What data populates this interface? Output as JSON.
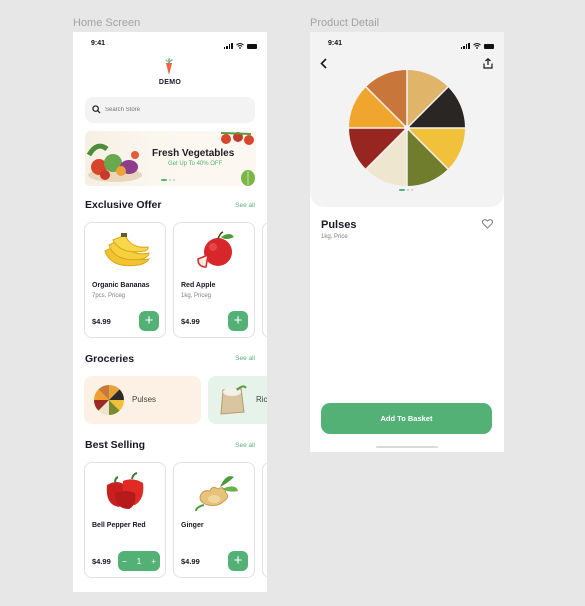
{
  "frames": {
    "home_label": "Home Screen",
    "detail_label": "Product Detail"
  },
  "colors": {
    "accent": "#53b175",
    "text": "#181725",
    "muted": "#7c7c7c",
    "card_border": "#e2e2e2",
    "canvas": "#e7e7e7"
  },
  "home": {
    "status_time": "9:41",
    "brand": "DEMO",
    "search": {
      "placeholder": "Search Store",
      "value": ""
    },
    "banner": {
      "title": "Fresh Vegetables",
      "subtitle": "Get Up To 40% OFF",
      "slides": 3,
      "active_slide": 1
    },
    "exclusive": {
      "title": "Exclusive Offer",
      "see_all": "See all",
      "items": [
        {
          "name": "Organic Bananas",
          "meta": "7pcs, Priceg",
          "price": "$4.99",
          "icon": "banana-icon"
        },
        {
          "name": "Red Apple",
          "meta": "1kg, Priceg",
          "price": "$4.99",
          "icon": "apple-icon"
        }
      ]
    },
    "groceries": {
      "title": "Groceries",
      "see_all": "See all",
      "items": [
        {
          "name": "Pulses",
          "icon": "pulses-icon",
          "bg": "#fdf0e4"
        },
        {
          "name": "Ric",
          "icon": "rice-icon",
          "bg": "#e5f3ea"
        }
      ]
    },
    "best_selling": {
      "title": "Best Selling",
      "see_all": "See all",
      "items": [
        {
          "name": "Bell Pepper Red",
          "price": "$4.99",
          "qty": "1",
          "icon": "bell-pepper-icon"
        },
        {
          "name": "Ginger",
          "price": "$4.99",
          "icon": "ginger-icon"
        }
      ]
    }
  },
  "detail": {
    "status_time": "9:41",
    "product_name": "Pulses",
    "product_meta": "1kg, Price",
    "add_button": "Add To Basket",
    "slides": 3,
    "active_slide": 1
  }
}
